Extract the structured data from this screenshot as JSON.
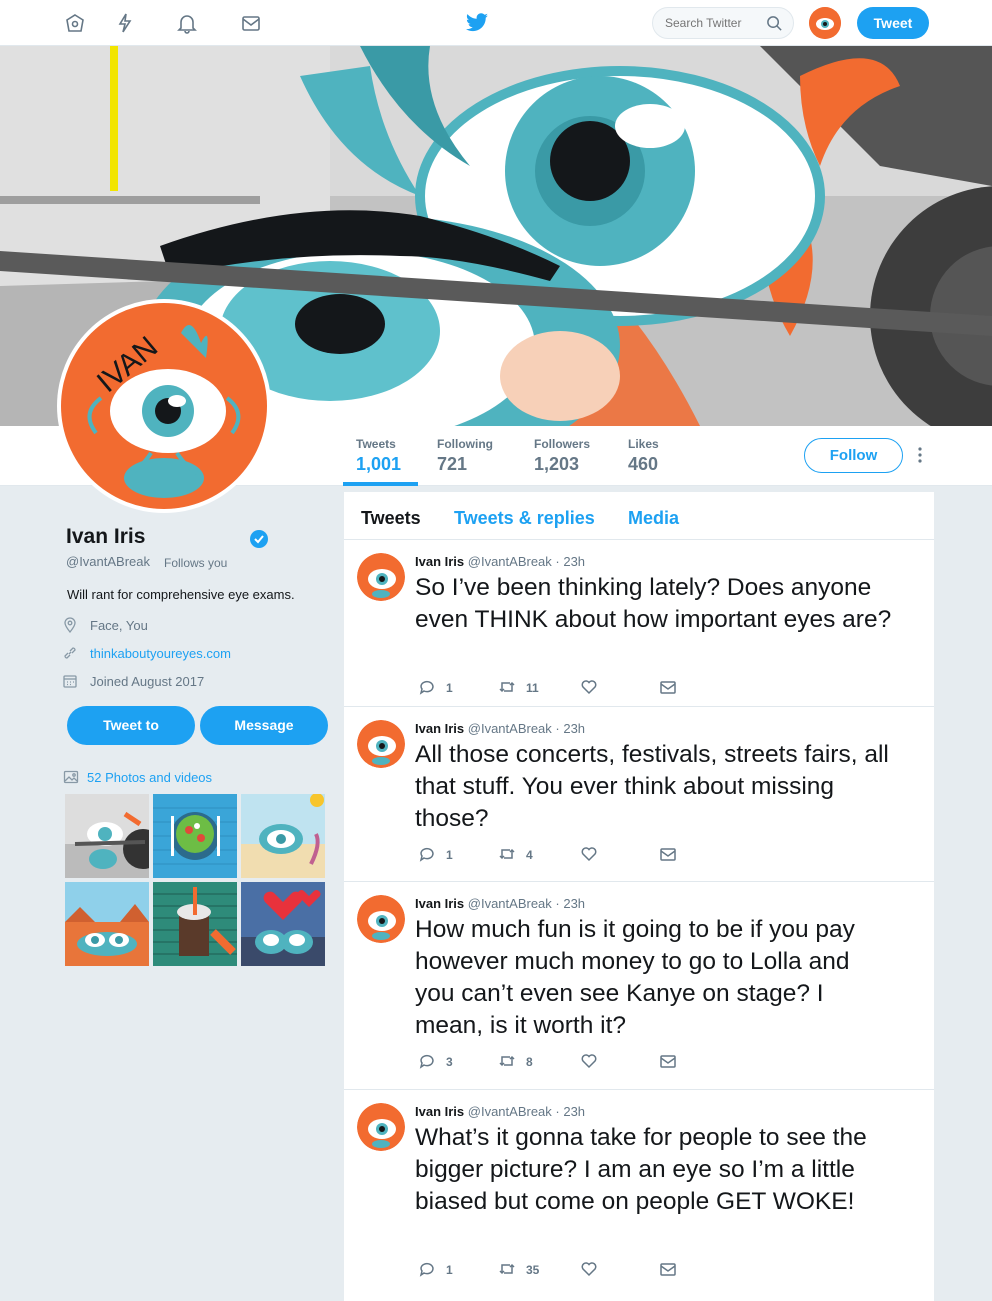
{
  "topbar": {
    "search_placeholder": "Search Twitter",
    "tweet_button": "Tweet",
    "icons": [
      "home-icon",
      "moments-icon",
      "notifications-icon",
      "messages-icon",
      "twitter-bird-icon",
      "search-icon"
    ]
  },
  "profile": {
    "name": "Ivan Iris",
    "handle": "@IvantABreak",
    "follows_you": "Follows you",
    "bio": "Will rant for comprehensive eye exams.",
    "location": "Face, You",
    "website": "thinkaboutyoureyes.com",
    "joined": "Joined August 2017",
    "avatar_text": "IVAN",
    "tweet_to_button": "Tweet to",
    "message_button": "Message",
    "photos_link": "52 Photos and videos"
  },
  "stats": [
    {
      "label": "Tweets",
      "value": "1,001"
    },
    {
      "label": "Following",
      "value": "721"
    },
    {
      "label": "Followers",
      "value": "1,203"
    },
    {
      "label": "Likes",
      "value": "460"
    }
  ],
  "follow_button": "Follow",
  "tabs": [
    "Tweets",
    "Tweets & replies",
    "Media"
  ],
  "tweets": [
    {
      "name": "Ivan Iris",
      "handle": "@IvantABreak",
      "time": "· 23h",
      "text": "So I’ve been thinking lately? Does anyone even THINK about how important eyes are?",
      "replies": "1",
      "retweets": "11"
    },
    {
      "name": "Ivan Iris",
      "handle": "@IvantABreak",
      "time": "· 23h",
      "text": "All those concerts, festivals, streets fairs, all that stuff. You ever think about missing those?",
      "replies": "1",
      "retweets": "4"
    },
    {
      "name": "Ivan Iris",
      "handle": "@IvantABreak",
      "time": "· 23h",
      "text": "How much fun is it going to be if you pay however much money to go to Lolla and you can’t even see Kanye on stage? I mean, is it worth it?",
      "replies": "3",
      "retweets": "8"
    },
    {
      "name": "Ivan Iris",
      "handle": "@IvantABreak",
      "time": "· 23h",
      "text": "What’s it gonna take for people to see the bigger picture? I am an eye so I’m a little biased but come on people GET WOKE!",
      "replies": "1",
      "retweets": "35"
    }
  ],
  "colors": {
    "accent": "#1da1f2",
    "avatar_orange": "#f26b30",
    "iris_teal": "#4fb3bf"
  }
}
